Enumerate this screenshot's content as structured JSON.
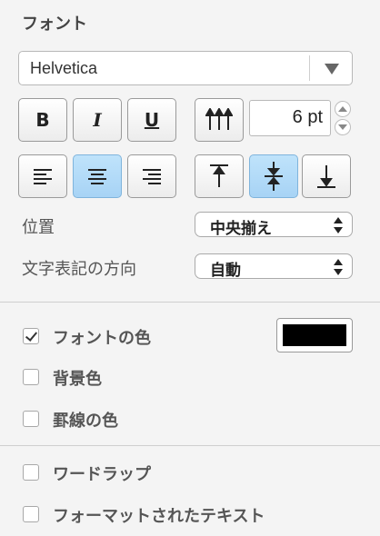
{
  "section": {
    "title": "フォント"
  },
  "font": {
    "family": "Helvetica"
  },
  "style_buttons": [
    {
      "label": "B"
    },
    {
      "label": "I"
    },
    {
      "label": "U"
    }
  ],
  "size": {
    "value": "6 pt"
  },
  "position": {
    "label": "位置",
    "value": "中央揃え"
  },
  "direction": {
    "label": "文字表記の方向",
    "value": "自動"
  },
  "font_color": {
    "label": "フォントの色",
    "checked": true,
    "color": "#000000"
  },
  "background_color": {
    "label": "背景色",
    "checked": false
  },
  "border_color": {
    "label": "罫線の色",
    "checked": false
  },
  "word_wrap": {
    "label": "ワードラップ",
    "checked": false
  },
  "formatted_text": {
    "label": "フォーマットされたテキスト",
    "checked": false
  },
  "colors": {
    "active": "#a7d3f5"
  }
}
